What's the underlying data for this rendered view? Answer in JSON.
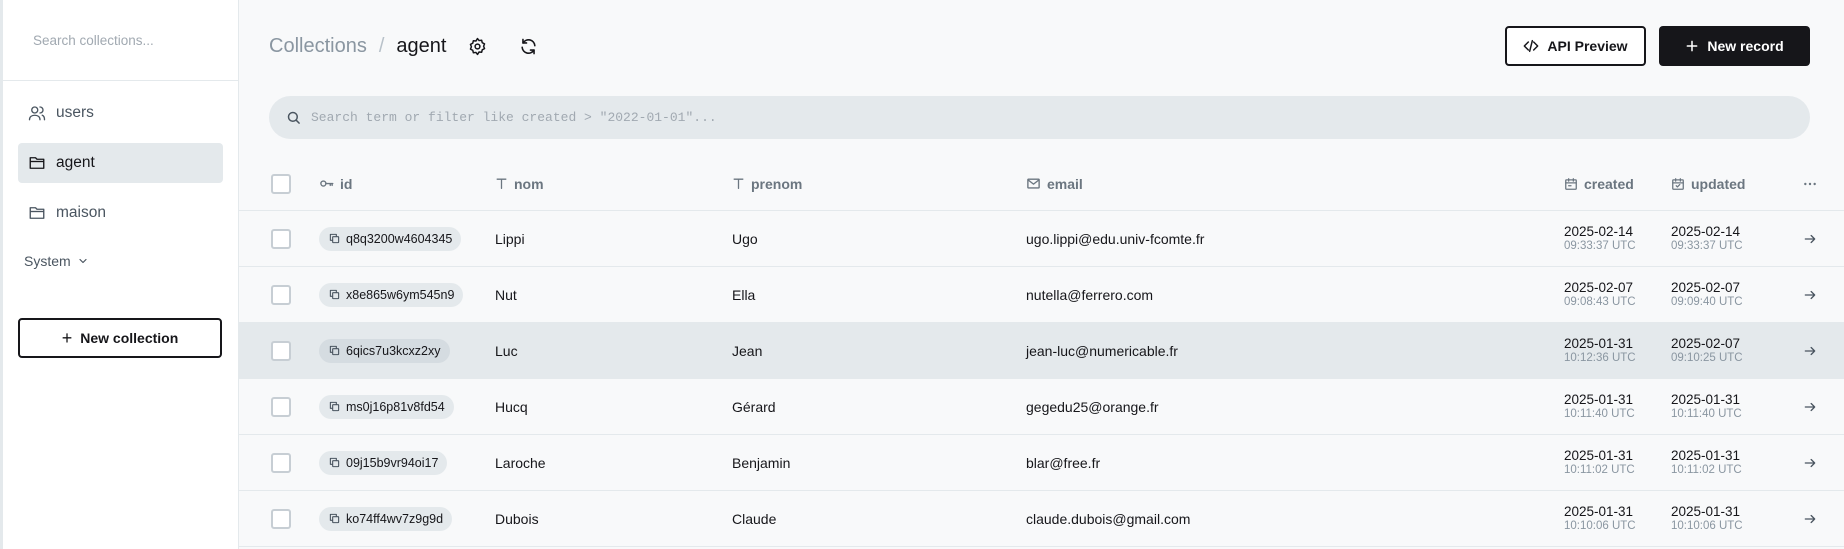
{
  "sidebar": {
    "search_placeholder": "Search collections...",
    "items": [
      {
        "label": "users",
        "icon": "users-icon",
        "active": false
      },
      {
        "label": "agent",
        "icon": "folder-icon",
        "active": true
      },
      {
        "label": "maison",
        "icon": "folder-icon",
        "active": false
      }
    ],
    "system_label": "System",
    "new_collection_label": "New collection"
  },
  "header": {
    "breadcrumb_root": "Collections",
    "breadcrumb_separator": "/",
    "breadcrumb_current": "agent",
    "api_preview_label": "API Preview",
    "new_record_label": "New record"
  },
  "search": {
    "placeholder": "Search term or filter like created > \"2022-01-01\"..."
  },
  "table": {
    "columns": {
      "id": "id",
      "nom": "nom",
      "prenom": "prenom",
      "email": "email",
      "created": "created",
      "updated": "updated"
    },
    "rows": [
      {
        "id": "q8q3200w4604345",
        "nom": "Lippi",
        "prenom": "Ugo",
        "email": "ugo.lippi@edu.univ-fcomte.fr",
        "created_date": "2025-02-14",
        "created_time": "09:33:37 UTC",
        "updated_date": "2025-02-14",
        "updated_time": "09:33:37 UTC"
      },
      {
        "id": "x8e865w6ym545n9",
        "nom": "Nut",
        "prenom": "Ella",
        "email": "nutella@ferrero.com",
        "created_date": "2025-02-07",
        "created_time": "09:08:43 UTC",
        "updated_date": "2025-02-07",
        "updated_time": "09:09:40 UTC"
      },
      {
        "id": "6qics7u3kcxz2xy",
        "nom": "Luc",
        "prenom": "Jean",
        "email": "jean-luc@numericable.fr",
        "created_date": "2025-01-31",
        "created_time": "10:12:36 UTC",
        "updated_date": "2025-02-07",
        "updated_time": "09:10:25 UTC"
      },
      {
        "id": "ms0j16p81v8fd54",
        "nom": "Hucq",
        "prenom": "Gérard",
        "email": "gegedu25@orange.fr",
        "created_date": "2025-01-31",
        "created_time": "10:11:40 UTC",
        "updated_date": "2025-01-31",
        "updated_time": "10:11:40 UTC"
      },
      {
        "id": "09j15b9vr94oi17",
        "nom": "Laroche",
        "prenom": "Benjamin",
        "email": "blar@free.fr",
        "created_date": "2025-01-31",
        "created_time": "10:11:02 UTC",
        "updated_date": "2025-01-31",
        "updated_time": "10:11:02 UTC"
      },
      {
        "id": "ko74ff4wv7z9g9d",
        "nom": "Dubois",
        "prenom": "Claude",
        "email": "claude.dubois@gmail.com",
        "created_date": "2025-01-31",
        "created_time": "10:10:06 UTC",
        "updated_date": "2025-01-31",
        "updated_time": "10:10:06 UTC"
      }
    ]
  },
  "colors": {
    "accent": "#16161a",
    "sidebar_active_bg": "#e4e9ec",
    "muted_text": "#8a96a1"
  }
}
